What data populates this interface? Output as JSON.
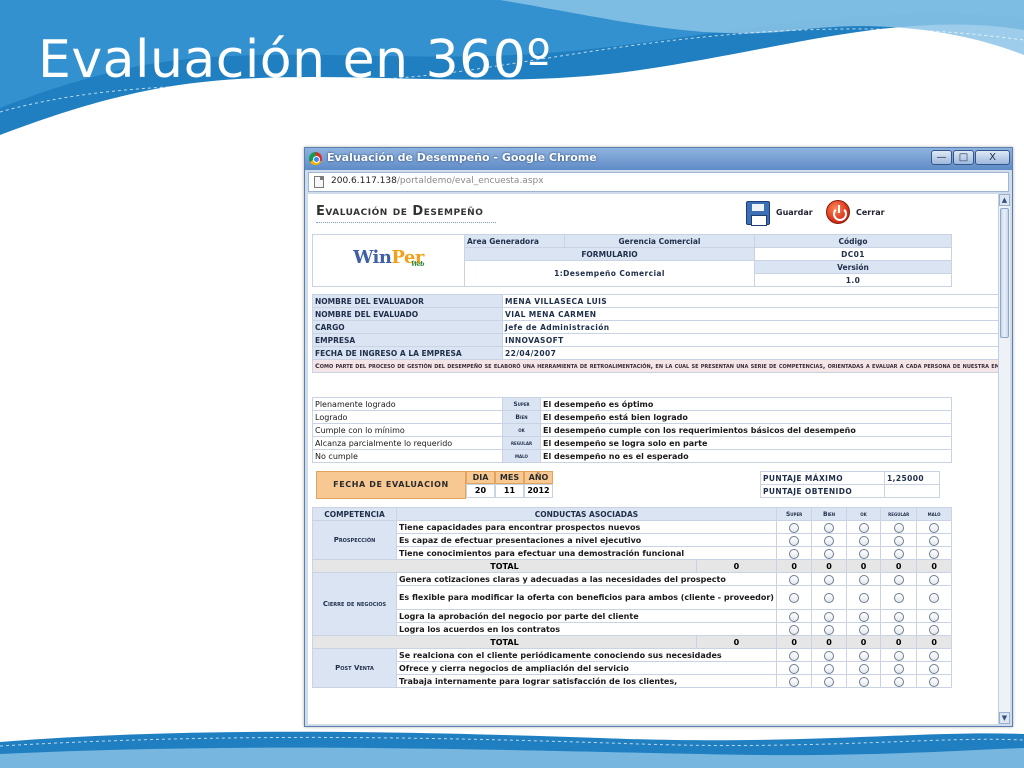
{
  "slide": {
    "title": "Evaluación en 360º",
    "theme_colors": {
      "wave_dark": "#1f7fc0",
      "wave_light": "#8cc4e6"
    }
  },
  "browser": {
    "window_title": "Evaluación de Desempeño - Google Chrome",
    "controls": {
      "minimize": "—",
      "maximize": "□",
      "close": "X"
    },
    "url_host": "200.6.117.138",
    "url_path": "/portaldemo/eval_encuesta.aspx"
  },
  "page": {
    "title": "Evaluación de Desempeño",
    "toolbar": {
      "save_label": "Guardar",
      "close_label": "Cerrar"
    },
    "header": {
      "area_label": "Area Generadora",
      "area_value": "Gerencia Comercial",
      "codigo_label": "Código",
      "codigo_value": "DC01",
      "formulario_label": "FORMULARIO",
      "formulario_value": "1:Desempeño Comercial",
      "version_label": "Versión",
      "version_value": "1.0",
      "logo_text_a": "Win",
      "logo_text_b": "Per",
      "logo_sub": "Web"
    },
    "evaluator": [
      {
        "label": "NOMBRE DEL EVALUADOR",
        "value": "MENA VILLASECA LUIS"
      },
      {
        "label": "NOMBRE DEL EVALUADO",
        "value": "VIAL MENA CARMEN"
      },
      {
        "label": "CARGO",
        "value": "Jefe de Administración"
      },
      {
        "label": "EMPRESA",
        "value": "INNOVASOFT"
      },
      {
        "label": "FECHA DE INGRESO A LA EMPRESA",
        "value": "22/04/2007"
      }
    ],
    "note": "Como parte del proceso de gestión del desempeño se elaboró una herramienta de retroalimentación, en la cual se presentan una serie de competencias, orientadas a evaluar a cada persona de nuestra empresa, que ejerca un rol de jefatura, las cuales deberá ponderar colocando un X en cada una de las conductas asociadas a su respectiva competencia. La calificación va desde totalmente de acuerdo a totalmente en desacuerdo, entendiendo que:",
    "scale": [
      {
        "name": "Plenamente logrado",
        "code": "Super",
        "desc": "El desempeño es óptimo"
      },
      {
        "name": "Logrado",
        "code": "Bien",
        "desc": "El desempeño está bien logrado"
      },
      {
        "name": "Cumple con lo mínimo",
        "code": "ok",
        "desc": "El desempeño cumple con los requerimientos básicos del desempeño"
      },
      {
        "name": "Alcanza parcialmente lo requerido",
        "code": "regular",
        "desc": "El desempeño se logra solo en parte"
      },
      {
        "name": "No cumple",
        "code": "malo",
        "desc": "El desempeño no es el esperado"
      }
    ],
    "fecha": {
      "label": "FECHA DE EVALUACION",
      "dia_label": "DIA",
      "mes_label": "MES",
      "ano_label": "AÑO",
      "dia": "20",
      "mes": "11",
      "ano": "2012"
    },
    "puntaje": {
      "max_label": "PUNTAJE MÁXIMO",
      "max_value": "1,25000",
      "obt_label": "PUNTAJE OBTENIDO",
      "obt_value": ""
    },
    "eval_table": {
      "col_competencia": "COMPETENCIA",
      "col_conductas": "CONDUCTAS ASOCIADAS",
      "cols": [
        "Super",
        "Bien",
        "ok",
        "regular",
        "malo"
      ],
      "total_label": "TOTAL",
      "competencias": [
        {
          "name": "Prospección",
          "conductas": [
            "Tiene capacidades para encontrar prospectos nuevos",
            "Es capaz de efectuar presentaciones a nivel ejecutivo",
            "Tiene conocimientos para efectuar una demostración funcional"
          ],
          "totals": [
            "0",
            "0",
            "0",
            "0",
            "0",
            "0"
          ]
        },
        {
          "name": "Cierre de negocios",
          "conductas": [
            "Genera cotizaciones claras y adecuadas a las necesidades del prospecto",
            "Es flexible para modificar la oferta con beneficios para ambos (cliente - proveedor)",
            "Logra la aprobación del negocio por parte del cliente",
            "Logra los acuerdos en los contratos"
          ],
          "totals": [
            "0",
            "0",
            "0",
            "0",
            "0",
            "0"
          ]
        },
        {
          "name": "Post Venta",
          "conductas": [
            "Se realciona con el cliente periódicamente conociendo sus necesidades",
            "Ofrece y cierra negocios de ampliación del servicio",
            "Trabaja internamente para lograr satisfacción de los clientes,"
          ]
        }
      ]
    }
  }
}
